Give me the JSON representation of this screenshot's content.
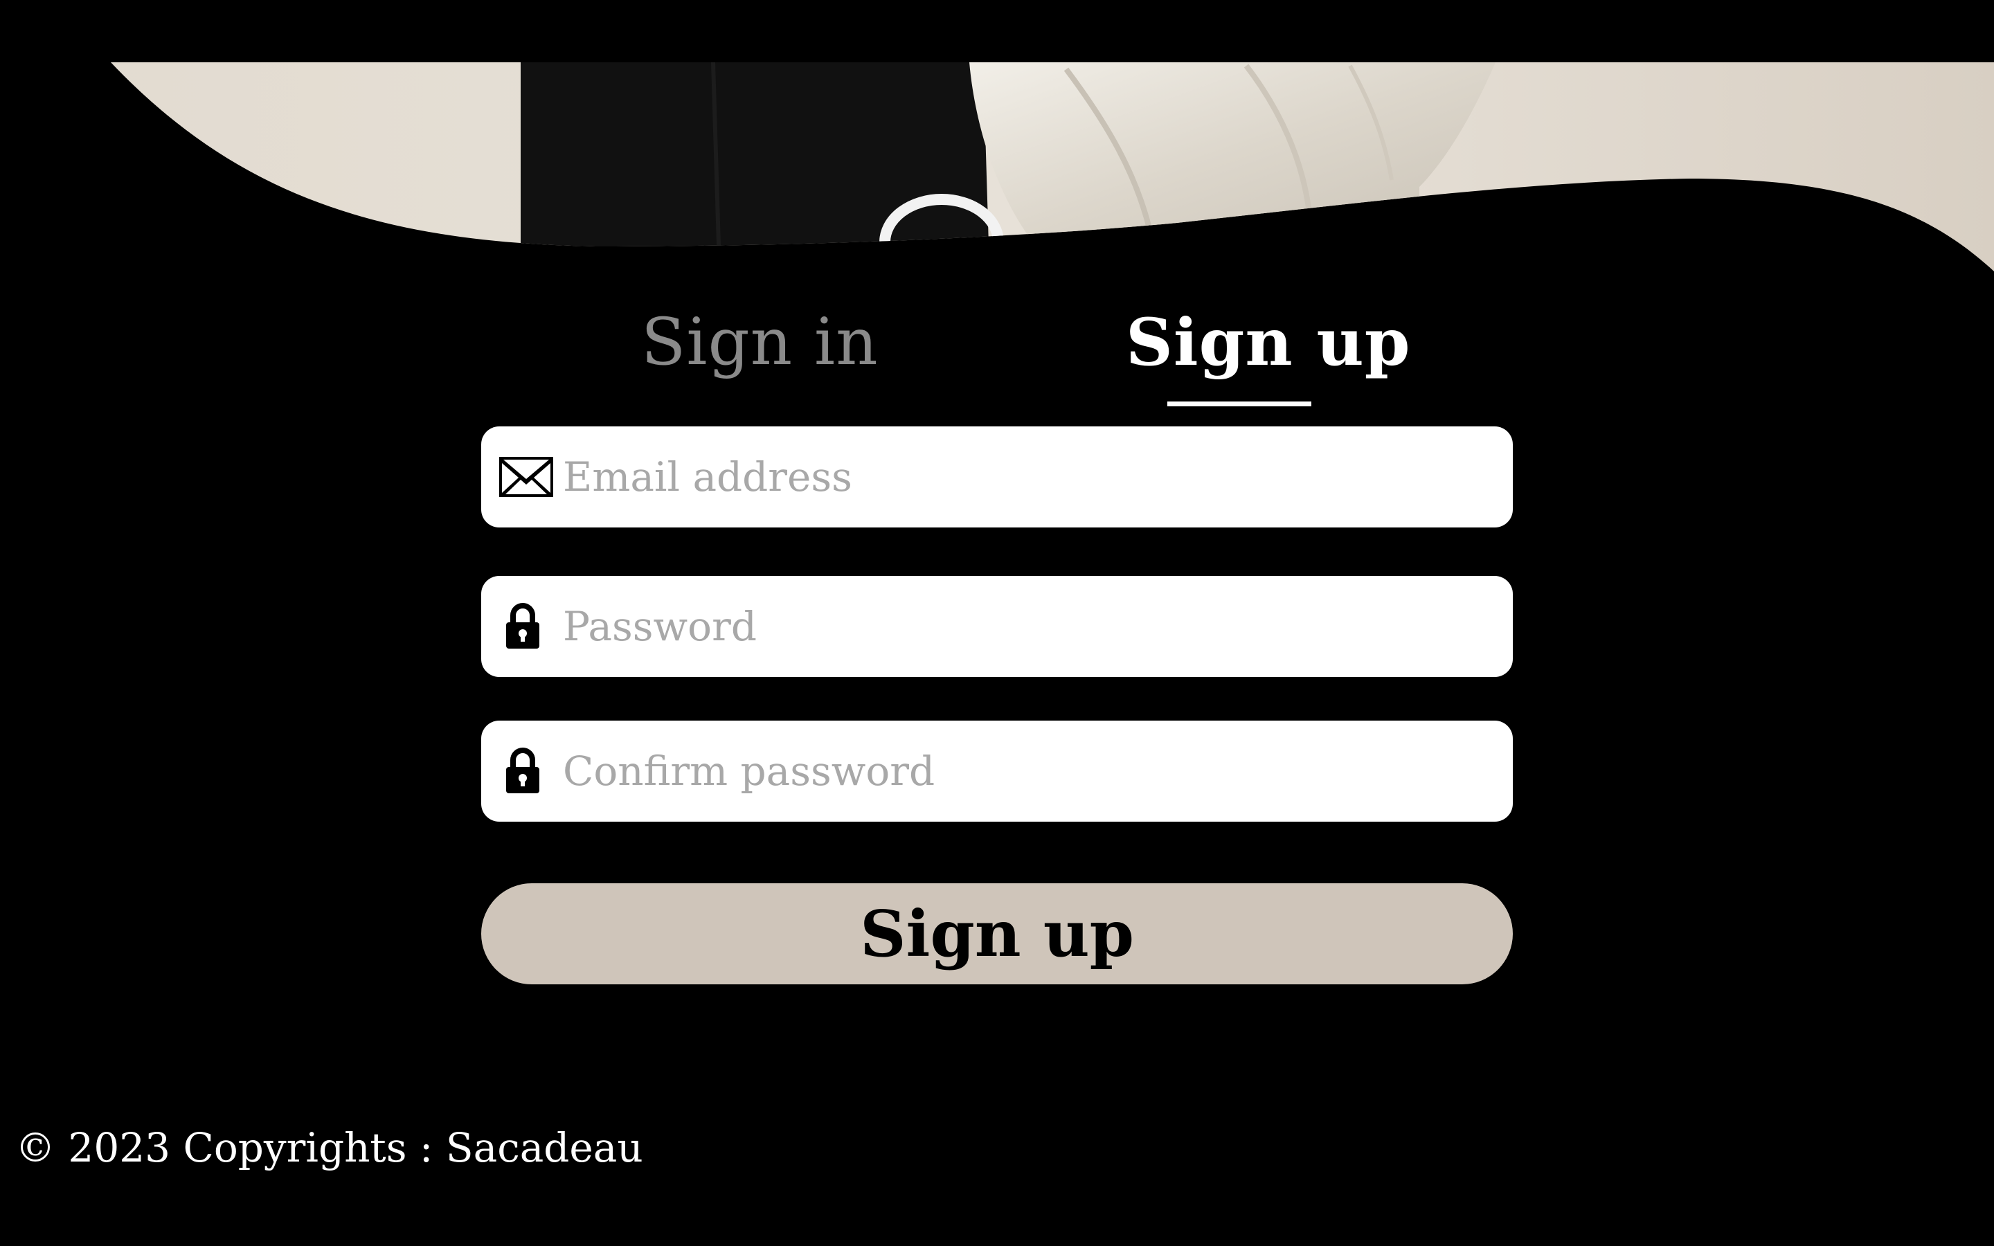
{
  "tabs": {
    "signin_label": "Sign in",
    "signup_label": "Sign up",
    "active": "signup"
  },
  "form": {
    "email": {
      "placeholder": "Email address",
      "value": "",
      "icon": "envelope-icon"
    },
    "password": {
      "placeholder": "Password",
      "value": "",
      "icon": "lock-icon"
    },
    "confirm_password": {
      "placeholder": "Confirm password",
      "value": "",
      "icon": "lock-icon"
    },
    "submit_label": "Sign up"
  },
  "footer": {
    "copyright": "© 2023 Copyrights : Sacadeau"
  },
  "colors": {
    "background": "#000000",
    "field_background": "#ffffff",
    "placeholder": "#a8a8a8",
    "inactive_tab": "#8a8a8a",
    "button_background": "#cfc5ba",
    "hero_beige": "#e4ddd3"
  }
}
